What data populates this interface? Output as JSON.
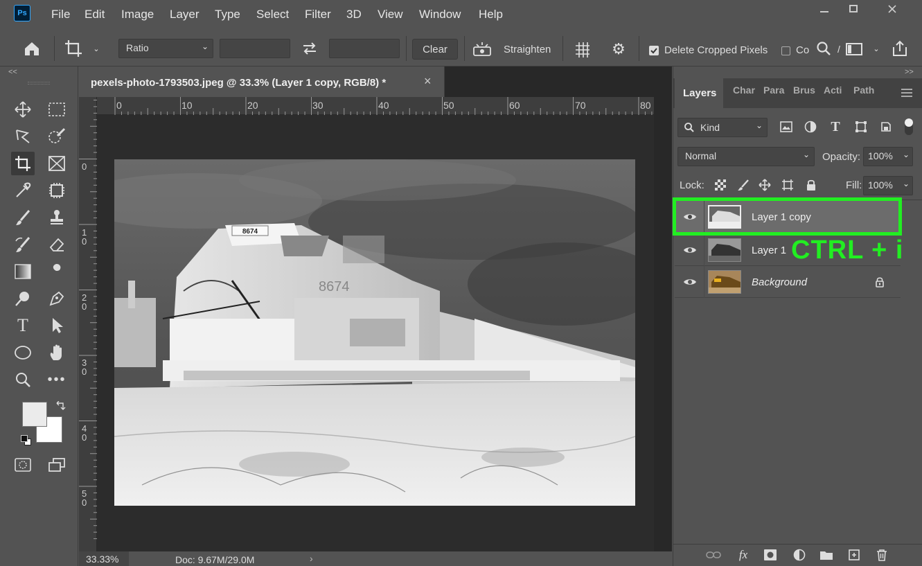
{
  "menu": {
    "logo": "Ps",
    "items": [
      "File",
      "Edit",
      "Image",
      "Layer",
      "Type",
      "Select",
      "Filter",
      "3D",
      "View",
      "Window",
      "Help"
    ]
  },
  "options": {
    "ratio": "Ratio",
    "clear": "Clear",
    "straighten": "Straighten",
    "delete_cropped": "Delete Cropped Pixels",
    "content_aware": "Co",
    "delete_checked": true
  },
  "document": {
    "tab_title": "pexels-photo-1793503.jpeg @ 33.3% (Layer 1 copy, RGB/8) *",
    "close": "×",
    "zoom": "33.33%",
    "doc_info": "Doc: 9.67M/29.0M",
    "ruler_top": [
      "0",
      "10",
      "20",
      "30",
      "40",
      "50",
      "60",
      "70",
      "80"
    ],
    "ruler_left": [
      "0",
      "1 0",
      "2 0",
      "3 0",
      "4 0",
      "5 0"
    ]
  },
  "toolbox": {
    "collapse": "<<"
  },
  "panel": {
    "expand": ">>",
    "tabs": [
      "Layers",
      "Char",
      "Para",
      "Brus",
      "Acti",
      "Path"
    ],
    "kind": "Kind",
    "blend_mode": "Normal",
    "opacity_label": "Opacity:",
    "opacity": "100%",
    "lock_label": "Lock:",
    "fill_label": "Fill:",
    "fill": "100%",
    "layers": [
      {
        "name": "Layer 1 copy",
        "selected": true
      },
      {
        "name": "Layer 1",
        "selected": false
      },
      {
        "name": "Background",
        "selected": false,
        "locked": true
      }
    ]
  },
  "annotation": {
    "shortcut": "CTRL + i",
    "color": "#22ee22"
  }
}
